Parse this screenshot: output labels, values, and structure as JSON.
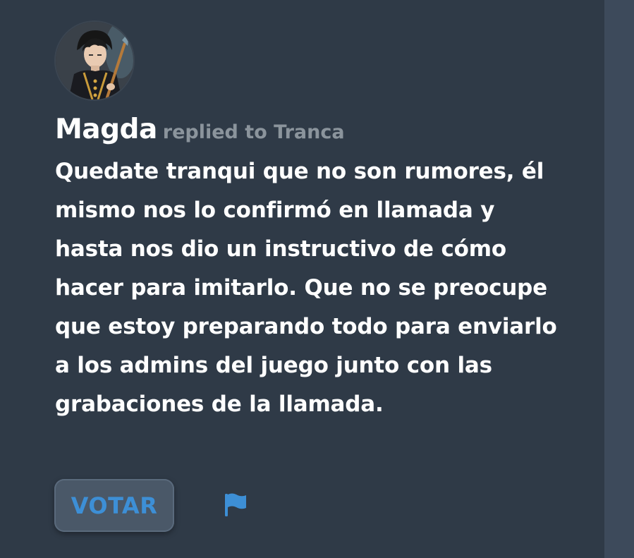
{
  "post": {
    "author": "Magda",
    "replied_to": "replied to Tranca",
    "body": "Quedate tranqui que no son rumores, él mismo nos lo confirmó en llamada y hasta nos dio un instructivo de cómo hacer para imitarlo. Que no se preocupe que estoy preparando todo para enviarlo a los admins del juego junto con las grabaciones de la llamada.",
    "avatar_icon": "avatar-illustration",
    "vote_label": "VOTAR",
    "flag_icon": "flag-icon"
  },
  "colors": {
    "background": "#2f3a47",
    "side_panel": "#3d4a5b",
    "vote_text": "#3d8fd6",
    "muted": "#8b949c"
  }
}
